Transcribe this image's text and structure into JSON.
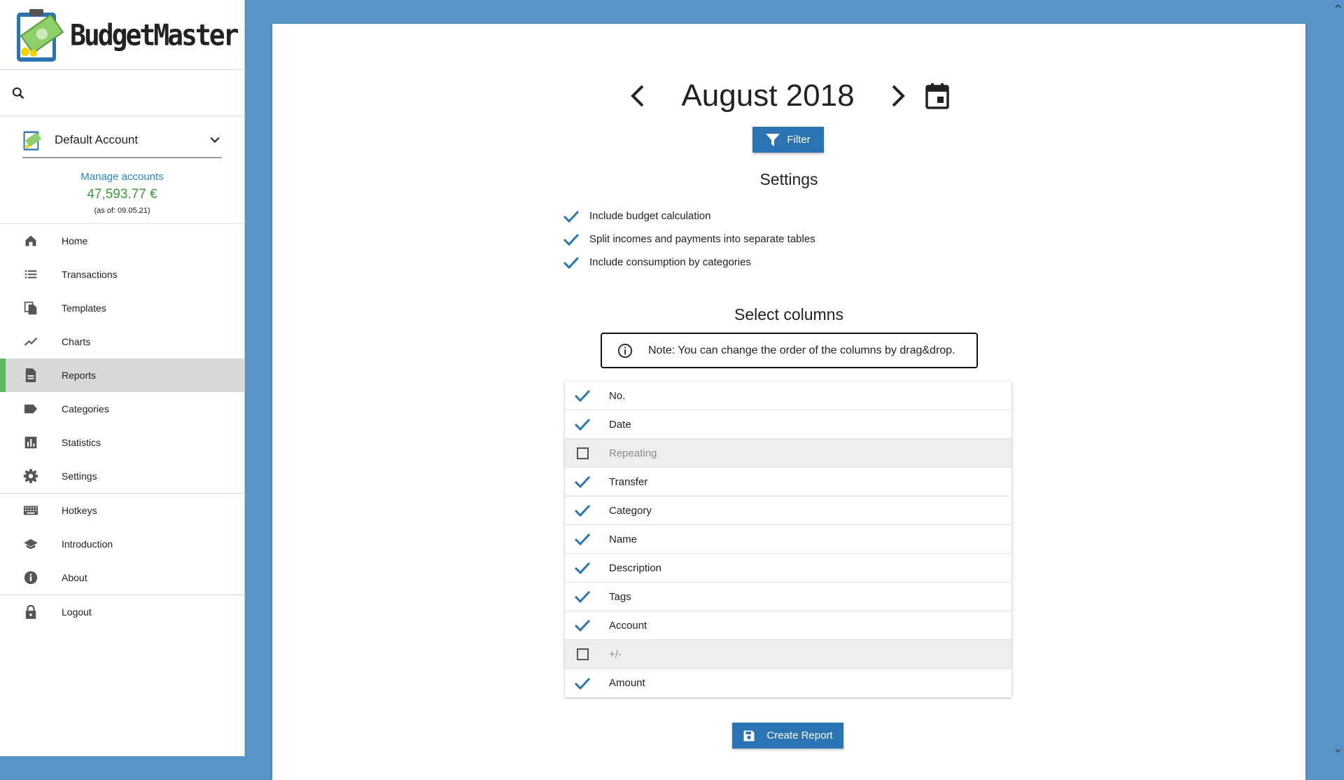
{
  "app": {
    "name": "BudgetMaster"
  },
  "account": {
    "name": "Default Account",
    "manage_label": "Manage accounts",
    "balance": "47,593.77 €",
    "as_of": "(as of: 09.05.21)"
  },
  "nav": {
    "items": [
      {
        "label": "Home",
        "icon": "home-icon"
      },
      {
        "label": "Transactions",
        "icon": "list-icon"
      },
      {
        "label": "Templates",
        "icon": "file-copy-icon"
      },
      {
        "label": "Charts",
        "icon": "line-chart-icon"
      },
      {
        "label": "Reports",
        "icon": "description-icon",
        "active": true
      },
      {
        "label": "Categories",
        "icon": "label-icon"
      },
      {
        "label": "Statistics",
        "icon": "bar-chart-icon"
      },
      {
        "label": "Settings",
        "icon": "gear-icon"
      }
    ],
    "secondary": [
      {
        "label": "Hotkeys",
        "icon": "keyboard-icon"
      },
      {
        "label": "Introduction",
        "icon": "school-icon"
      },
      {
        "label": "About",
        "icon": "info-icon"
      }
    ],
    "logout": {
      "label": "Logout",
      "icon": "lock-icon"
    }
  },
  "header": {
    "month": "August 2018"
  },
  "filter": {
    "label": "Filter"
  },
  "settings": {
    "title": "Settings",
    "options": [
      {
        "label": "Include budget calculation",
        "checked": true
      },
      {
        "label": "Split incomes and payments into separate tables",
        "checked": true
      },
      {
        "label": "Include consumption by categories",
        "checked": true
      }
    ]
  },
  "columns": {
    "title": "Select columns",
    "note": "Note: You can change the order of the columns by drag&drop.",
    "items": [
      {
        "label": "No.",
        "checked": true
      },
      {
        "label": "Date",
        "checked": true
      },
      {
        "label": "Repeating",
        "checked": false
      },
      {
        "label": "Transfer",
        "checked": true
      },
      {
        "label": "Category",
        "checked": true
      },
      {
        "label": "Name",
        "checked": true
      },
      {
        "label": "Description",
        "checked": true
      },
      {
        "label": "Tags",
        "checked": true
      },
      {
        "label": "Account",
        "checked": true
      },
      {
        "label": "+/-",
        "checked": false
      },
      {
        "label": "Amount",
        "checked": true
      }
    ]
  },
  "actions": {
    "create_report": "Create Report"
  },
  "colors": {
    "accent": "#2a74b4",
    "link": "#2a85c7",
    "balance": "#3b9b3b",
    "active_marker": "#5cb85c",
    "background": "#5a94c8"
  }
}
